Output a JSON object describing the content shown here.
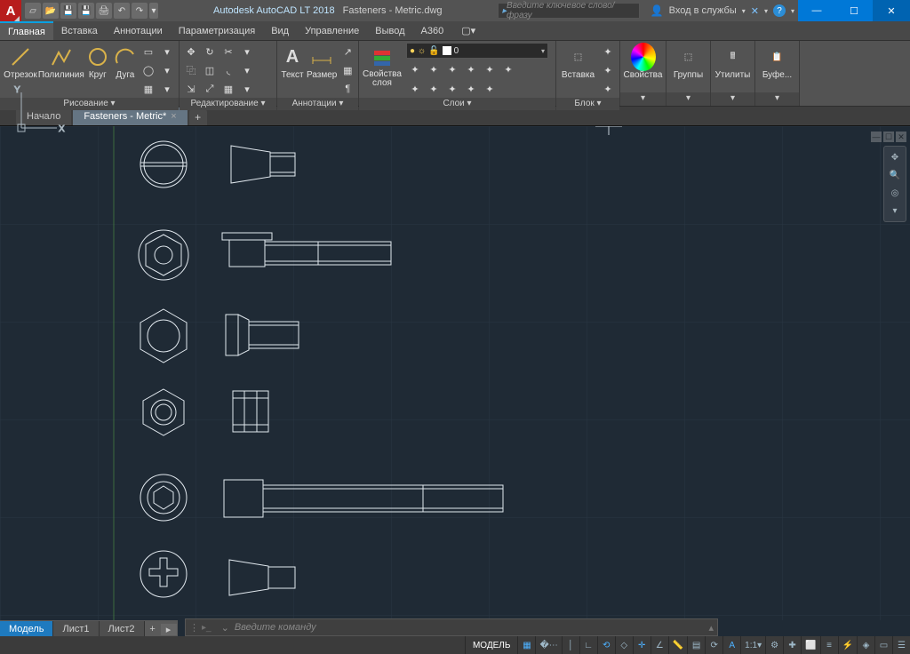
{
  "app": {
    "logo_letter": "A",
    "title": "Autodesk AutoCAD LT 2018",
    "filename": "Fasteners - Metric.dwg"
  },
  "title_search_placeholder": "Введите ключевое слово/фразу",
  "signin": {
    "label": "Вход в службы"
  },
  "window_controls": {
    "min": "—",
    "max": "☐",
    "close": "✕"
  },
  "menus": [
    "Главная",
    "Вставка",
    "Аннотации",
    "Параметризация",
    "Вид",
    "Управление",
    "Вывод",
    "A360"
  ],
  "ribbon": {
    "draw": {
      "title": "Рисование ▾",
      "line": "Отрезок",
      "pline": "Полилиния",
      "circle": "Круг",
      "arc": "Дуга"
    },
    "edit": {
      "title": "Редактирование ▾"
    },
    "anno": {
      "title": "Аннотации ▾",
      "text": "Текст",
      "dim": "Размер"
    },
    "layers": {
      "title": "Слои ▾",
      "props": "Свойства\nслоя",
      "current": "0"
    },
    "block": {
      "title": "Блок ▾",
      "insert": "Вставка"
    },
    "props": {
      "title": "▾",
      "label": "Свойства"
    },
    "groups": {
      "title": "▾",
      "label": "Группы"
    },
    "utils": {
      "title": "▾",
      "label": "Утилиты"
    },
    "clip": {
      "title": "▾",
      "label": "Буфе..."
    }
  },
  "filetabs": {
    "start": "Начало",
    "current": "Fasteners - Metric*"
  },
  "layouts": {
    "model": "Модель",
    "s1": "Лист1",
    "s2": "Лист2"
  },
  "cmd": {
    "placeholder": "Введите команду"
  },
  "status": {
    "model": "МОДЕЛЬ",
    "scale": "1:1"
  }
}
